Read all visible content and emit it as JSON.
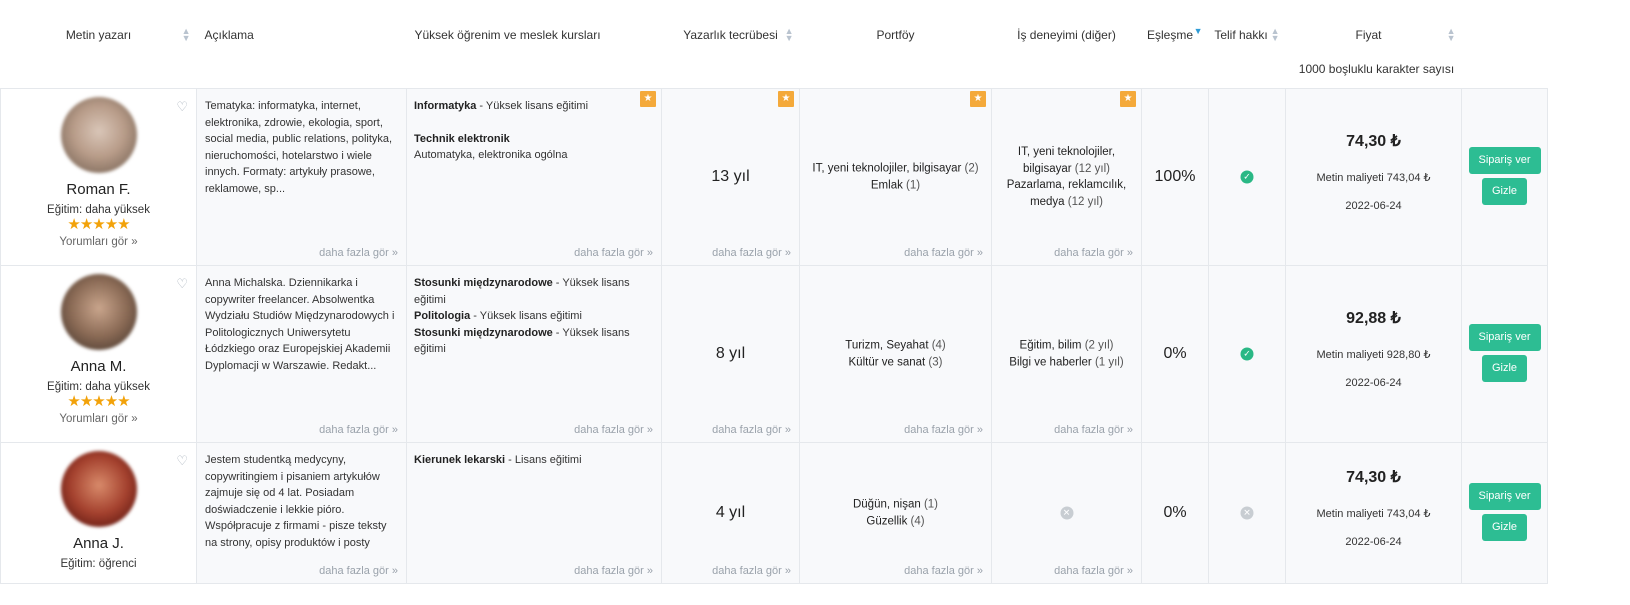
{
  "headers": {
    "author": "Metin yazarı",
    "description": "Açıklama",
    "education": "Yüksek öğrenim ve meslek kursları",
    "experience": "Yazarlık tecrübesi",
    "portfolio": "Portföy",
    "work": "İş deneyimi (diğer)",
    "match": "Eşleşme",
    "copyright": "Telif hakkı",
    "price": "Fiyat",
    "price_sub": "1000 boşluklu karakter sayısı"
  },
  "common": {
    "see_more": "daha fazla gör »",
    "see_reviews": "Yorumları gör »",
    "order_btn": "Sipariş ver",
    "hide_btn": "Gizle",
    "stars": "★★★★★",
    "heart": "♡",
    "badge": "★"
  },
  "colors": {
    "accent": "#2dbd93",
    "badge": "#f4a93a",
    "stars": "#f2a20a",
    "sort_active": "#2e9bd6"
  },
  "rows": [
    {
      "name": "Roman F.",
      "education_label": "Eğitim: daha yüksek",
      "rating": 5,
      "description": "Tematyka: informatyka, internet, elektronika, zdrowie, ekologia, sport, social media, public relations, polityka, nieruchomości, hotelarstwo i wiele innych. Formaty: artykuły prasowe, reklamowe, sp...",
      "edu": [
        {
          "field": "Informatyka",
          "level": " - Yüksek lisans eğitimi"
        },
        {
          "field": "Technik elektronik",
          "level": "Automatyka, elektronika ogólna"
        }
      ],
      "experience": "13 yıl",
      "portfolio": [
        {
          "label": "IT, yeni teknolojiler, bilgisayar",
          "count": " (2)"
        },
        {
          "label": "Emlak",
          "count": " (1)"
        }
      ],
      "work": [
        {
          "label": "IT, yeni teknolojiler, bilgisayar",
          "count": " (12 yıl)"
        },
        {
          "label": "Pazarlama, reklamcılık, medya",
          "count": " (12 yıl)"
        }
      ],
      "match": "100%",
      "copyright": "yes",
      "price": "74,30 ₺",
      "cost": "Metin maliyeti 743,04 ₺",
      "date": "2022-06-24"
    },
    {
      "name": "Anna M.",
      "education_label": "Eğitim: daha yüksek",
      "rating": 5,
      "description": "Anna Michalska. Dziennikarka i copywriter freelancer.  Absolwentka Wydziału Studiów Międzynarodowych i Politologicznych Uniwersytetu Łódzkiego oraz Europejskiej Akademii Dyplomacji w Warszawie. Redakt...",
      "edu": [
        {
          "field": "Stosunki międzynarodowe",
          "level": " - Yüksek lisans eğitimi"
        },
        {
          "field": "Politologia",
          "level": " - Yüksek lisans eğitimi"
        },
        {
          "field": "Stosunki międzynarodowe",
          "level": " - Yüksek lisans eğitimi"
        }
      ],
      "experience": "8 yıl",
      "portfolio": [
        {
          "label": "Turizm, Seyahat",
          "count": " (4)"
        },
        {
          "label": "Kültür ve sanat",
          "count": " (3)"
        }
      ],
      "work": [
        {
          "label": "Eğitim, bilim",
          "count": " (2 yıl)"
        },
        {
          "label": "Bilgi ve haberler",
          "count": " (1 yıl)"
        }
      ],
      "match": "0%",
      "copyright": "yes",
      "price": "92,88 ₺",
      "cost": "Metin maliyeti 928,80 ₺",
      "date": "2022-06-24"
    },
    {
      "name": "Anna J.",
      "education_label": "Eğitim: öğrenci",
      "rating": 0,
      "description": "Jestem studentką medycyny, copywritingiem i pisaniem artykułów zajmuje się od 4 lat. Posiadam doświadczenie i lekkie pióro. Współpracuje z firmami - pisze teksty na strony, opisy produktów i posty",
      "edu": [
        {
          "field": "Kierunek lekarski",
          "level": " - Lisans eğitimi"
        }
      ],
      "experience": "4 yıl",
      "portfolio": [
        {
          "label": "Düğün, nişan",
          "count": " (1)"
        },
        {
          "label": "Güzellik",
          "count": " (4)"
        }
      ],
      "work": [],
      "match": "0%",
      "copyright": "no",
      "price": "74,30 ₺",
      "cost": "Metin maliyeti 743,04 ₺",
      "date": "2022-06-24"
    }
  ]
}
